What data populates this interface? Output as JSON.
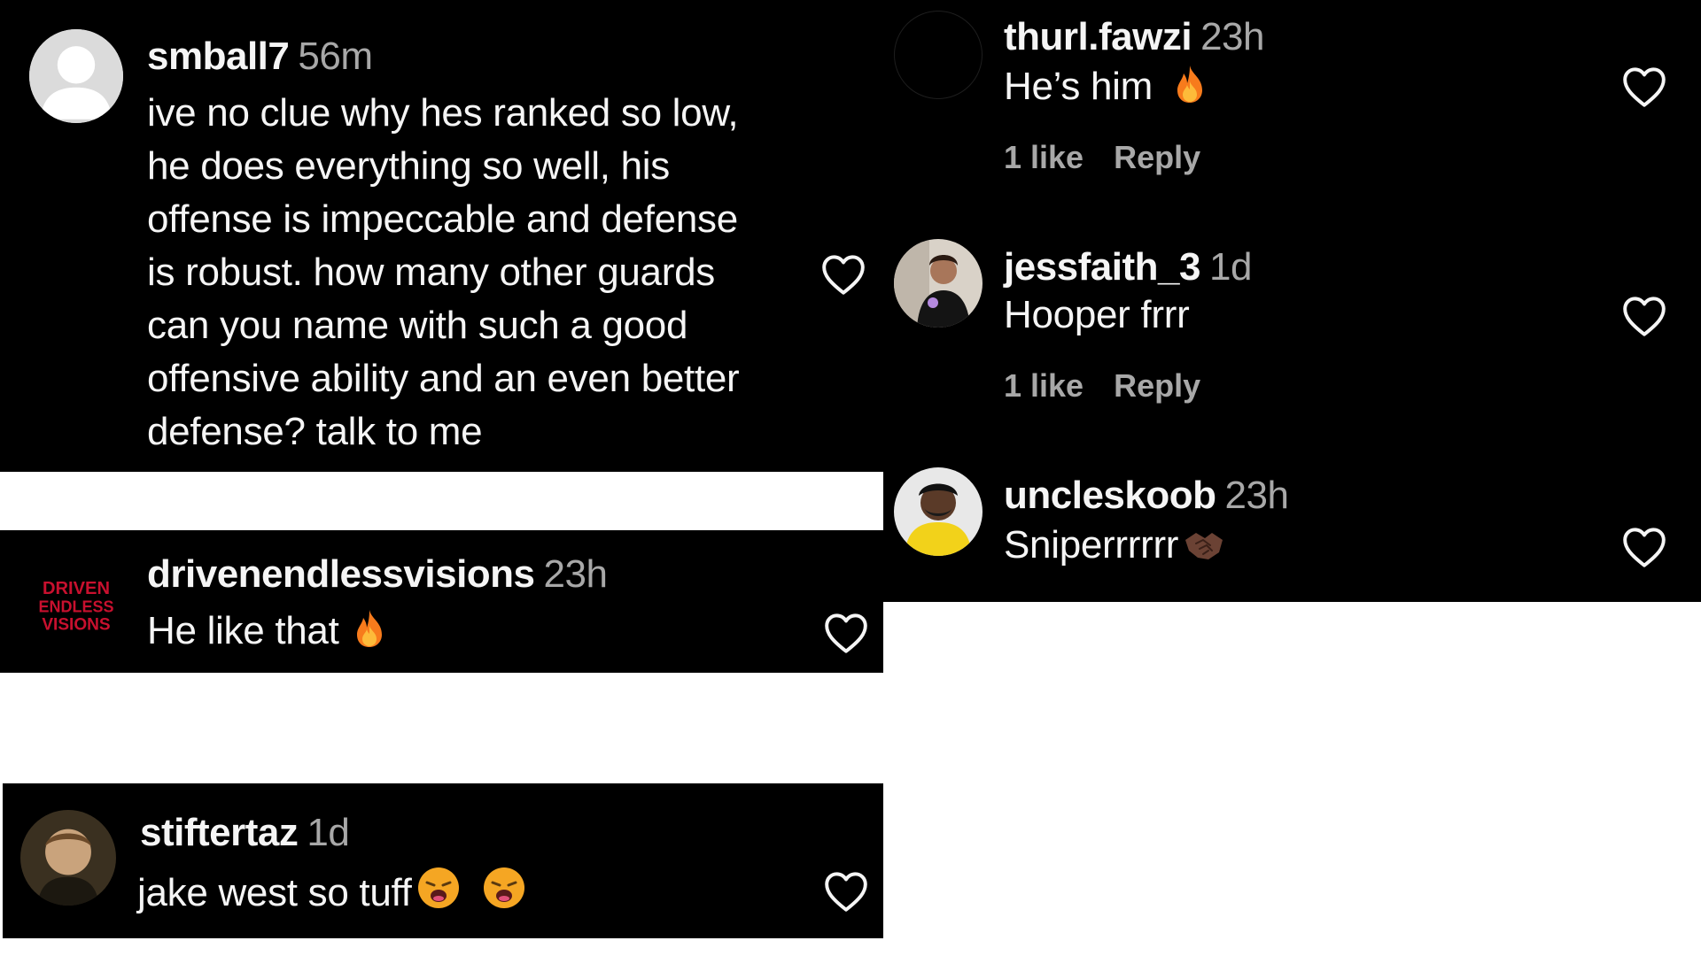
{
  "comments": [
    {
      "username": "smball7",
      "time": "56m",
      "text_lines": [
        "ive no clue why hes ranked so low,",
        "he does everything so well, his",
        "offense is impeccable and defense",
        "is robust. how many other guards",
        "can you name with such a good",
        "offensive ability and an even better",
        "defense? talk to me"
      ],
      "avatar": "default-profile-icon"
    },
    {
      "username": "drivenendlessvisions",
      "time": "23h",
      "text": "He like that",
      "emoji": "fire-emoji",
      "avatar": "brand-logo",
      "avatar_text": [
        "DRIVEN",
        "ENDLESS",
        "VISIONS"
      ]
    },
    {
      "username": "stiftertaz",
      "time": "1d",
      "text": "jake west so tuff",
      "emoji": "weary-face-emoji",
      "avatar": "portrait-photo"
    },
    {
      "username": "thurl.fawzi",
      "time": "23h",
      "text": "He’s him",
      "emoji": "fire-emoji",
      "likes": "1 like",
      "reply": "Reply",
      "avatar": "blank-dark-avatar"
    },
    {
      "username": "jessfaith_3",
      "time": "1d",
      "text": "Hooper frrr",
      "likes": "1 like",
      "reply": "Reply",
      "avatar": "selfie-photo"
    },
    {
      "username": "uncleskoob",
      "time": "23h",
      "text": "Sniperrrrrr",
      "emoji": "handshake-emoji",
      "avatar": "portrait-photo"
    }
  ],
  "colors": {
    "panel_bg": "#000000",
    "text": "#f5f5f5",
    "secondary": "#a8a8a8",
    "page_bg": "#ffffff"
  }
}
